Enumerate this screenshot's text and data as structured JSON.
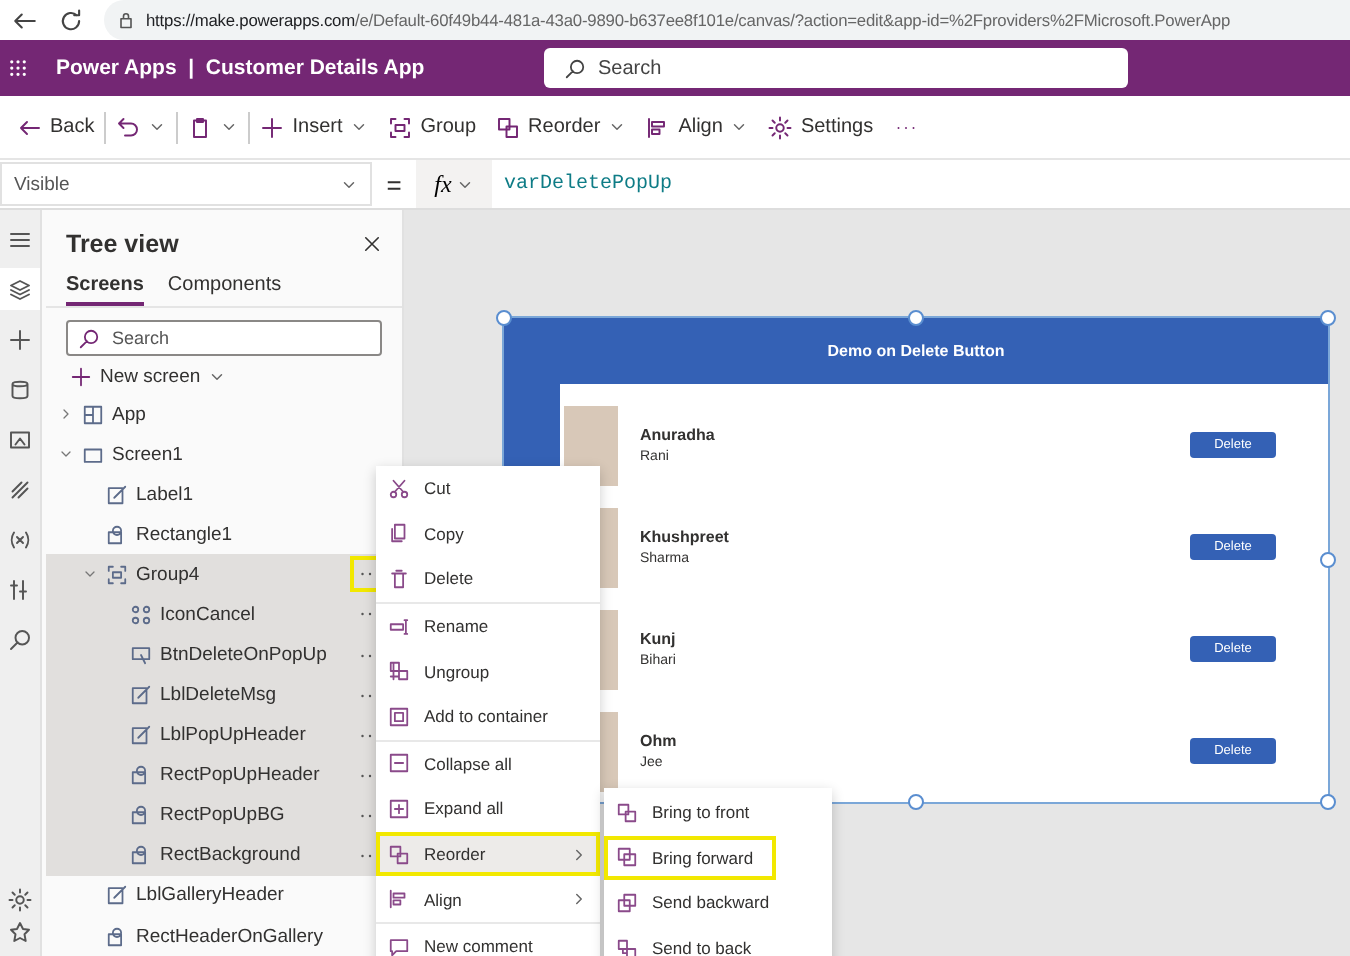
{
  "browser": {
    "url_host": "https://make.powerapps.com",
    "url_path": "/e/Default-60f49b44-481a-43a0-9890-b637ee8f101e/canvas/?action=edit&app-id=%2Fproviders%2FMicrosoft.PowerApp"
  },
  "header": {
    "product": "Power Apps",
    "separator": "|",
    "app_name": "Customer Details App",
    "search": {
      "placeholder": "Search"
    }
  },
  "toolbar": [
    {
      "kind": "back",
      "label": "Back",
      "dropdown": false
    },
    {
      "kind": "undo",
      "dropdown": true
    },
    {
      "kind": "paste",
      "dropdown": true
    },
    {
      "kind": "plus",
      "label": "Insert",
      "dropdown": true
    },
    {
      "kind": "group",
      "label": "Group",
      "dropdown": false
    },
    {
      "kind": "reorder",
      "label": "Reorder",
      "dropdown": true
    },
    {
      "kind": "align",
      "label": "Align",
      "dropdown": true
    },
    {
      "kind": "gear",
      "label": "Settings",
      "dropdown": false
    },
    {
      "kind": "more",
      "dropdown": false
    }
  ],
  "formula_bar": {
    "property": "Visible",
    "equals": "=",
    "fx": "fx",
    "formula": "varDeletePopUp"
  },
  "rail": [
    {
      "kind": "menu",
      "selected": false
    },
    {
      "kind": "layers",
      "selected": true
    },
    {
      "kind": "plus",
      "selected": false
    },
    {
      "kind": "database",
      "selected": false
    },
    {
      "kind": "media",
      "selected": false
    },
    {
      "kind": "theme",
      "selected": false
    },
    {
      "kind": "variables",
      "selected": false
    },
    {
      "kind": "tools",
      "selected": false
    },
    {
      "kind": "search",
      "selected": false
    }
  ],
  "tree_view": {
    "title": "Tree view",
    "tabs": [
      {
        "label": "Screens",
        "selected": true
      },
      {
        "label": "Components",
        "selected": false
      }
    ],
    "search": {
      "placeholder": "Search"
    },
    "new_screen": "New screen",
    "items": [
      {
        "label": "App",
        "kind": "app",
        "expanded": false,
        "selected": false,
        "annotated": false
      },
      {
        "label": "Screen1",
        "kind": "screen",
        "expanded": true,
        "selected": false,
        "annotated": false,
        "children": [
          {
            "label": "Label1",
            "kind": "label",
            "selected": false,
            "annotated": false
          },
          {
            "label": "Rectangle1",
            "kind": "rect",
            "selected": false,
            "annotated": false
          },
          {
            "label": "Group4",
            "kind": "group",
            "expanded": true,
            "selected": true,
            "annotated": true,
            "children": [
              {
                "label": "IconCancel",
                "kind": "icon",
                "selected": true,
                "annotated": false
              },
              {
                "label": "BtnDeleteOnPopUp",
                "kind": "button",
                "selected": true,
                "annotated": false
              },
              {
                "label": "LblDeleteMsg",
                "kind": "label",
                "selected": true,
                "annotated": false
              },
              {
                "label": "LblPopUpHeader",
                "kind": "label",
                "selected": true,
                "annotated": false
              },
              {
                "label": "RectPopUpHeader",
                "kind": "rect",
                "selected": true,
                "annotated": false
              },
              {
                "label": "RectPopUpBG",
                "kind": "rect",
                "selected": true,
                "annotated": false
              },
              {
                "label": "RectBackground",
                "kind": "rect",
                "selected": true,
                "annotated": false
              }
            ]
          },
          {
            "label": "LblGalleryHeader",
            "kind": "label",
            "selected": false,
            "annotated": false
          },
          {
            "label": "RectHeaderOnGallery",
            "kind": "rect",
            "selected": false,
            "annotated": false
          }
        ]
      }
    ]
  },
  "app_preview": {
    "selected": true,
    "title": "Demo on Delete Button",
    "rows": [
      {
        "first_name": "Anuradha",
        "last_name": "Rani",
        "button": "Delete"
      },
      {
        "first_name": "Khushpreet",
        "last_name": "Sharma",
        "button": "Delete"
      },
      {
        "first_name": "Kunj",
        "last_name": "Bihari",
        "button": "Delete"
      },
      {
        "first_name": "Ohm",
        "last_name": "Jee",
        "button": "Delete"
      }
    ]
  },
  "context_menu": {
    "groups": [
      [
        {
          "label": "Cut",
          "submenu": false,
          "selected": false,
          "annotated": false
        },
        {
          "label": "Copy",
          "submenu": false,
          "selected": false,
          "annotated": false
        },
        {
          "label": "Delete",
          "submenu": false,
          "selected": false,
          "annotated": false
        }
      ],
      [
        {
          "label": "Rename",
          "submenu": false,
          "selected": false,
          "annotated": false
        },
        {
          "label": "Ungroup",
          "submenu": false,
          "selected": false,
          "annotated": false
        },
        {
          "label": "Add to container",
          "submenu": false,
          "selected": false,
          "annotated": false
        }
      ],
      [
        {
          "label": "Collapse all",
          "submenu": false,
          "selected": false,
          "annotated": false
        },
        {
          "label": "Expand all",
          "submenu": false,
          "selected": false,
          "annotated": false
        },
        {
          "label": "Reorder",
          "submenu": true,
          "selected": true,
          "annotated": true
        },
        {
          "label": "Align",
          "submenu": true,
          "selected": false,
          "annotated": false
        }
      ],
      [
        {
          "label": "New comment",
          "submenu": false,
          "selected": false,
          "annotated": false
        }
      ]
    ]
  },
  "submenu": {
    "items": [
      {
        "label": "Bring to front",
        "annotated": false
      },
      {
        "label": "Bring forward",
        "annotated": true
      },
      {
        "label": "Send backward",
        "annotated": false
      },
      {
        "label": "Send to back",
        "annotated": false
      }
    ]
  }
}
